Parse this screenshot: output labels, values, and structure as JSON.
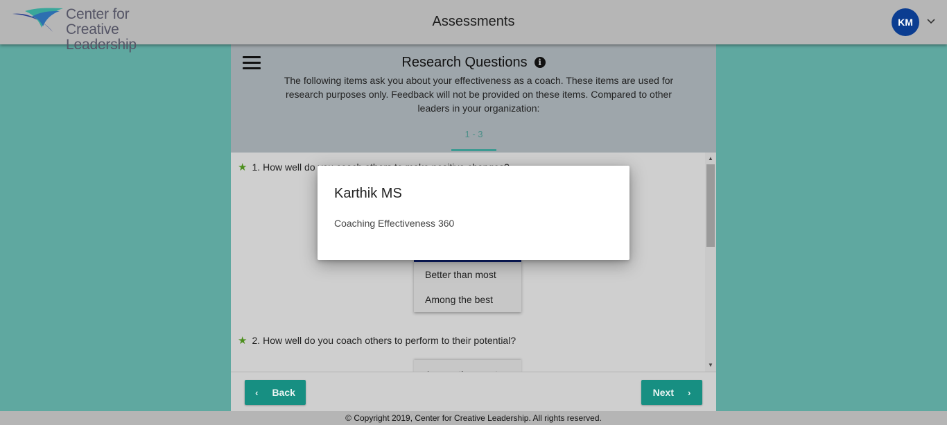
{
  "header": {
    "logo_line1": "Center for",
    "logo_line2": "Creative Leadership",
    "title": "Assessments",
    "avatar_initials": "KM",
    "avatar_color": "#0b3d91"
  },
  "section": {
    "title": "Research Questions",
    "description": "The following items ask you about your effectiveness as a coach. These items are used for research purposes only. Feedback will not be provided on these items. Compared to other leaders in your organization:",
    "page_range": "1 - 3"
  },
  "questions": [
    {
      "number": "1.",
      "text": "How well do you coach others to make positive changes?",
      "options_visible": [
        "Better than most",
        "Among the best"
      ]
    },
    {
      "number": "2.",
      "text": "How well do you coach others to perform to their potential?",
      "options_visible": [
        "Among the worst"
      ]
    }
  ],
  "nav": {
    "back_label": "Back",
    "next_label": "Next"
  },
  "footer": {
    "copyright": "© Copyright 2019, Center for Creative Leadership. All rights reserved."
  },
  "modal": {
    "title": "Karthik MS",
    "subtitle": "Coaching Effectiveness 360"
  },
  "colors": {
    "page_bg": "#5fa8a0",
    "accent": "#178f82",
    "star": "#4c8f1c"
  }
}
